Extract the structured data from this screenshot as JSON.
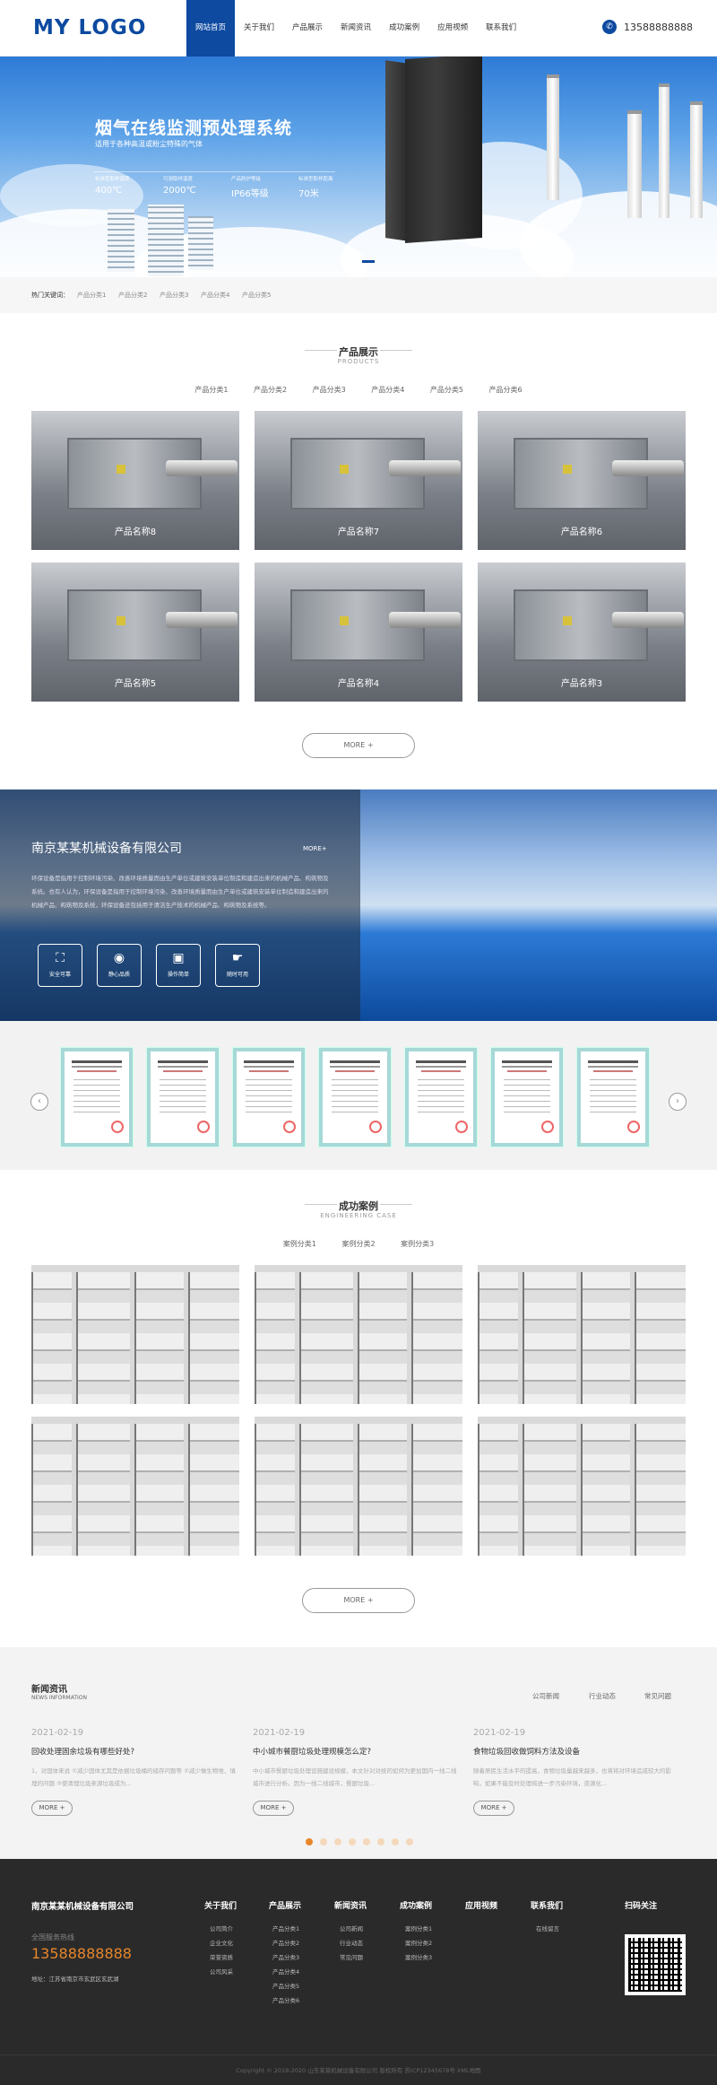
{
  "header": {
    "logo": "MY LOGO",
    "nav": [
      "网站首页",
      "关于我们",
      "产品展示",
      "新闻资讯",
      "成功案例",
      "应用视频",
      "联系我们"
    ],
    "phone": "13588888888",
    "phone_icon": "phone-icon"
  },
  "banner": {
    "title": "烟气在线监测预处理系统",
    "subtitle": "适用于各种高温或粉尘特殊的气体",
    "stats": [
      {
        "label": "标准型取样温度",
        "value": "400℃"
      },
      {
        "label": "可测取样温度",
        "value": "2000℃"
      },
      {
        "label": "产品防护等级",
        "value": "IP66等级"
      },
      {
        "label": "标准型取样距离",
        "value": "70米"
      }
    ]
  },
  "keywords": {
    "label": "热门关键词：",
    "items": [
      "产品分类1",
      "产品分类2",
      "产品分类3",
      "产品分类4",
      "产品分类5"
    ]
  },
  "products": {
    "title": "产品展示",
    "subtitle": "PRODUCTS",
    "tabs": [
      "产品分类1",
      "产品分类2",
      "产品分类3",
      "产品分类4",
      "产品分类5",
      "产品分类6"
    ],
    "items": [
      "产品名称8",
      "产品名称7",
      "产品名称6",
      "产品名称5",
      "产品名称4",
      "产品名称3"
    ],
    "more": "MORE +"
  },
  "about": {
    "title": "南京某某机械设备有限公司",
    "more": "MORE+",
    "text": "环保设备是指用于控制环境污染、改善环境质量而由生产单位或建筑安装单位制造和建造出来的机械产品、构筑物及系统。也有人认为，环保设备是指用于控制环境污染、改善环境质量而由生产单位或建筑安装单位制造和建造出来的机械产品、构筑物及系统，环保设备还包括用于清洁生产技术的机械产品、构筑物及系统等。",
    "features": [
      {
        "icon": "wash-icon",
        "label": "安全可靠"
      },
      {
        "icon": "signal-icon",
        "label": "静心品质"
      },
      {
        "icon": "bag-icon",
        "label": "操作简单"
      },
      {
        "icon": "hand-icon",
        "label": "随时可用"
      }
    ]
  },
  "certificates": {
    "prev": "‹",
    "next": "›",
    "count": 7
  },
  "cases": {
    "title": "成功案例",
    "subtitle": "ENGINEERING CASE",
    "tabs": [
      "案例分类1",
      "案例分类2",
      "案例分类3"
    ],
    "more": "MORE +"
  },
  "news": {
    "title": "新闻资讯",
    "subtitle": "NEWS INFORMATION",
    "tabs": [
      "公司新闻",
      "行业动态",
      "常见问题"
    ],
    "items": [
      {
        "date": "2021-02-19",
        "headline": "回收处理固余垃圾有哪些好处?",
        "summary": "1、对固体来说 ①减少固体尤其是依据垃圾桶的储存问题等 ②减少做生物堆、填埋的问题 ③使清理垃圾来源垃圾成为...",
        "more": "MORE +"
      },
      {
        "date": "2021-02-19",
        "headline": "中小城市餐厨垃圾处理规模怎么定?",
        "summary": "中小城市餐厨垃圾处理设施建设规模，本文针对对统的如何为更加国内一线二线城市进行分析。因为一线二线城市，餐厨垃圾...",
        "more": "MORE +"
      },
      {
        "date": "2021-02-19",
        "headline": "食物垃圾回收做饲料方法及设备",
        "summary": "随着居民生活水平的提高，食物垃圾量越来越多，也将将对环境造成较大的影响，如果不能及时处理将进一步污染环境，资源化...",
        "more": "MORE +"
      }
    ]
  },
  "footer": {
    "company": "南京某某机械设备有限公司",
    "hotline_label": "全国服务热线",
    "hotline": "13588888888",
    "address": "地址：江苏省南京市玄武区玄武湖",
    "columns": [
      {
        "heading": "关于我们",
        "items": [
          "公司简介",
          "企业文化",
          "荣誉资质",
          "公司风采"
        ]
      },
      {
        "heading": "产品展示",
        "items": [
          "产品分类1",
          "产品分类2",
          "产品分类3",
          "产品分类4",
          "产品分类5",
          "产品分类6"
        ]
      },
      {
        "heading": "新闻资讯",
        "items": [
          "公司新闻",
          "行业动态",
          "常见问题"
        ]
      },
      {
        "heading": "成功案例",
        "items": [
          "案例分类1",
          "案例分类2",
          "案例分类3"
        ]
      },
      {
        "heading": "应用视频",
        "items": []
      },
      {
        "heading": "联系我们",
        "items": [
          "在线留言"
        ]
      }
    ],
    "qr_heading": "扫码关注",
    "copyright": "Copyright © 2018-2020 山东某某机械设备有限公司 版权所有 苏ICP12345678号 XML地图"
  },
  "colors": {
    "brand": "#0d4aa0",
    "accent": "#e8862a",
    "footer_bg": "#2a2a2a"
  }
}
